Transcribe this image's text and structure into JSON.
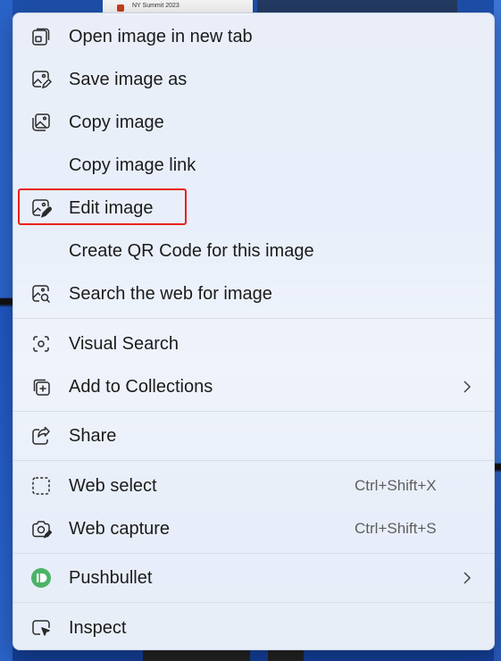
{
  "background": {
    "thumbnail_label": "NY Summit 2023"
  },
  "menu": {
    "items": [
      {
        "label": "Open image in new tab",
        "icon": "open-new-tab-icon"
      },
      {
        "label": "Save image as",
        "icon": "save-image-icon"
      },
      {
        "label": "Copy image",
        "icon": "copy-image-icon"
      },
      {
        "label": "Copy image link",
        "icon": ""
      },
      {
        "label": "Edit image",
        "icon": "edit-image-icon",
        "highlighted": true
      },
      {
        "label": "Create QR Code for this image",
        "icon": ""
      },
      {
        "label": "Search the web for image",
        "icon": "image-search-icon"
      },
      {
        "label": "Visual Search",
        "icon": "visual-search-icon"
      },
      {
        "label": "Add to Collections",
        "icon": "add-collection-icon",
        "submenu": true
      },
      {
        "label": "Share",
        "icon": "share-icon"
      },
      {
        "label": "Web select",
        "icon": "web-select-icon",
        "shortcut": "Ctrl+Shift+X"
      },
      {
        "label": "Web capture",
        "icon": "web-capture-icon",
        "shortcut": "Ctrl+Shift+S"
      },
      {
        "label": "Pushbullet",
        "icon": "pushbullet-icon",
        "submenu": true
      },
      {
        "label": "Inspect",
        "icon": "inspect-icon"
      }
    ]
  },
  "colors": {
    "highlight_border": "#e8231c",
    "pushbullet_green": "#4ab367",
    "menu_background": "#f0f4fb"
  }
}
